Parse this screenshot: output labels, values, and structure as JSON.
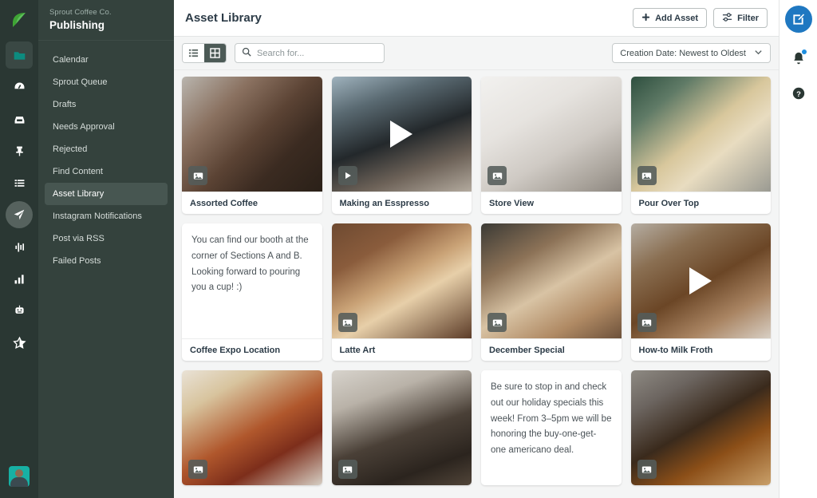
{
  "colors": {
    "rail_bg": "#2a3733",
    "sidebar_bg": "#34423d",
    "accent_green": "#3fa535",
    "teal": "#0d8b7f",
    "fab_blue": "#1f78c1",
    "notification_dot": "#1f8fe0",
    "active_nav": "#475651"
  },
  "rail": {
    "logo_icon": "sprout-leaf-logo",
    "icons": [
      {
        "name": "folder-icon",
        "active": true
      },
      {
        "name": "dashboard-gauge-icon",
        "active": false
      },
      {
        "name": "inbox-icon",
        "active": false
      },
      {
        "name": "pin-icon",
        "active": false
      },
      {
        "name": "list-icon",
        "active": false
      },
      {
        "name": "publish-paper-plane-icon",
        "active": true
      },
      {
        "name": "listening-waveform-icon",
        "active": false
      },
      {
        "name": "reports-bar-chart-icon",
        "active": false
      },
      {
        "name": "bot-icon",
        "active": false
      },
      {
        "name": "star-icon",
        "active": false
      }
    ],
    "avatar_name": "user-avatar"
  },
  "sidebar": {
    "org": "Sprout Coffee Co.",
    "title": "Publishing",
    "items": [
      {
        "label": "Calendar",
        "active": false
      },
      {
        "label": "Sprout Queue",
        "active": false
      },
      {
        "label": "Drafts",
        "active": false
      },
      {
        "label": "Needs Approval",
        "active": false
      },
      {
        "label": "Rejected",
        "active": false
      },
      {
        "label": "Find Content",
        "active": false
      },
      {
        "label": "Asset Library",
        "active": true
      },
      {
        "label": "Instagram Notifications",
        "active": false
      },
      {
        "label": "Post via RSS",
        "active": false
      },
      {
        "label": "Failed Posts",
        "active": false
      }
    ]
  },
  "header": {
    "title": "Asset Library",
    "add_asset_label": "Add Asset",
    "filter_label": "Filter"
  },
  "toolbar": {
    "view_list_label": "List view",
    "view_grid_label": "Grid view",
    "active_view": "grid",
    "search_placeholder": "Search for...",
    "search_value": "",
    "sort_value": "Creation Date: Newest to Oldest"
  },
  "right_rail": {
    "compose_label": "Compose",
    "notifications_label": "Notifications",
    "has_notification": true,
    "help_label": "Help"
  },
  "assets": [
    {
      "title": "Assorted Coffee",
      "type": "image",
      "badge": "image-icon",
      "has_play": false,
      "gradient": "linear-gradient(135deg,#b9b5ae 0%,#8a7160 28%,#5b4334 52%,#3b2b21 72%,#2a2018 100%)"
    },
    {
      "title": "Making an Esspresso",
      "type": "video",
      "badge": "play-icon",
      "has_play": true,
      "gradient": "linear-gradient(160deg,#9fb2bd 0%,#5a6a72 24%,#23282b 52%,#6d6258 76%,#b3aa9e 100%)"
    },
    {
      "title": "Store View",
      "type": "image",
      "badge": "image-icon",
      "has_play": false,
      "gradient": "linear-gradient(150deg,#f2f1ef 0%,#e6e3df 35%,#cfcac4 62%,#a9a39b 85%,#8d8780 100%)"
    },
    {
      "title": "Pour Over Top",
      "type": "image",
      "badge": "image-icon",
      "has_play": false,
      "gradient": "linear-gradient(140deg,#2e4f3f 0%,#5f7a66 22%,#d8c79c 50%,#e8dcc0 66%,#9a9a92 100%)"
    },
    {
      "title": "Coffee Expo Location",
      "type": "text",
      "badge": "A",
      "has_play": false,
      "body": "You can find our booth at the corner of Sections A and B. Looking forward to pouring you a cup! :)"
    },
    {
      "title": "Latte Art",
      "type": "image",
      "badge": "image-icon",
      "has_play": false,
      "gradient": "linear-gradient(150deg,#6e4a31 0%,#8a5c3c 26%,#c9a276 48%,#e7cfa9 62%,#5c3c28 100%)"
    },
    {
      "title": "December Special",
      "type": "image",
      "badge": "image-icon",
      "has_play": false,
      "gradient": "linear-gradient(150deg,#3b3a35 0%,#8c7257 30%,#d8c3a4 54%,#b08a64 78%,#6d513a 100%)"
    },
    {
      "title": "How-to Milk Froth",
      "type": "video",
      "badge": "image-icon",
      "has_play": true,
      "gradient": "linear-gradient(150deg,#b5ada2 0%,#8a6f52 26%,#6b4626 52%,#a98462 76%,#d8cfc4 100%)"
    },
    {
      "title": "",
      "type": "image",
      "badge": "image-icon",
      "has_play": false,
      "gradient": "linear-gradient(150deg,#e9e2d6 0%,#d8c49e 22%,#b0572c 52%,#7d2e1b 72%,#d6cfc4 100%)"
    },
    {
      "title": "",
      "type": "image",
      "badge": "image-icon",
      "has_play": false,
      "gradient": "linear-gradient(160deg,#d7d3cc 0%,#b9b2a8 25%,#4a4037 55%,#2b241e 80%,#514539 100%)"
    },
    {
      "title": "",
      "type": "text",
      "badge": "A",
      "has_play": false,
      "body": "Be sure to stop in and check out our holiday specials this week! From 3–5pm we will be honoring the buy-one-get-one americano deal."
    },
    {
      "title": "",
      "type": "image",
      "badge": "image-icon",
      "has_play": false,
      "gradient": "linear-gradient(150deg,#8e8a83 0%,#6c6560 22%,#3a2a1c 48%,#8c4f18 70%,#c9a06a 100%)"
    }
  ]
}
